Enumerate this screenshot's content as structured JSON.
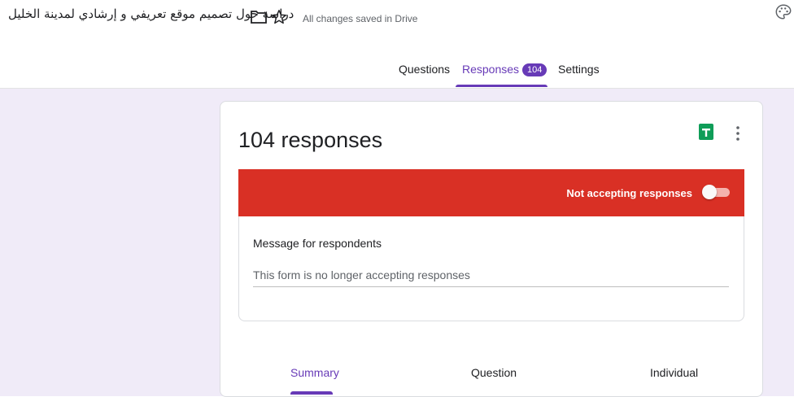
{
  "header": {
    "title": "دراسة حول تصميم موقع تعريفي و إرشادي لمدينة الخليل",
    "saved_status": "All changes saved in Drive",
    "icons": [
      "folder-icon",
      "star-icon",
      "palette-icon"
    ]
  },
  "tabs": [
    {
      "label": "Questions",
      "active": false
    },
    {
      "label": "Responses",
      "active": true,
      "badge": "104"
    },
    {
      "label": "Settings",
      "active": false
    }
  ],
  "card": {
    "title": "104 responses",
    "banner": {
      "text": "Not accepting responses",
      "color": "#d93025",
      "toggle_on": false
    },
    "message": {
      "label": "Message for respondents",
      "value": "This form is no longer accepting responses"
    },
    "subtabs": [
      {
        "label": "Summary",
        "active": true
      },
      {
        "label": "Question",
        "active": false
      },
      {
        "label": "Individual",
        "active": false
      }
    ]
  },
  "colors": {
    "accent": "#673ab7",
    "background": "#f0ebf8",
    "sheets_green": "#0f9d58"
  }
}
